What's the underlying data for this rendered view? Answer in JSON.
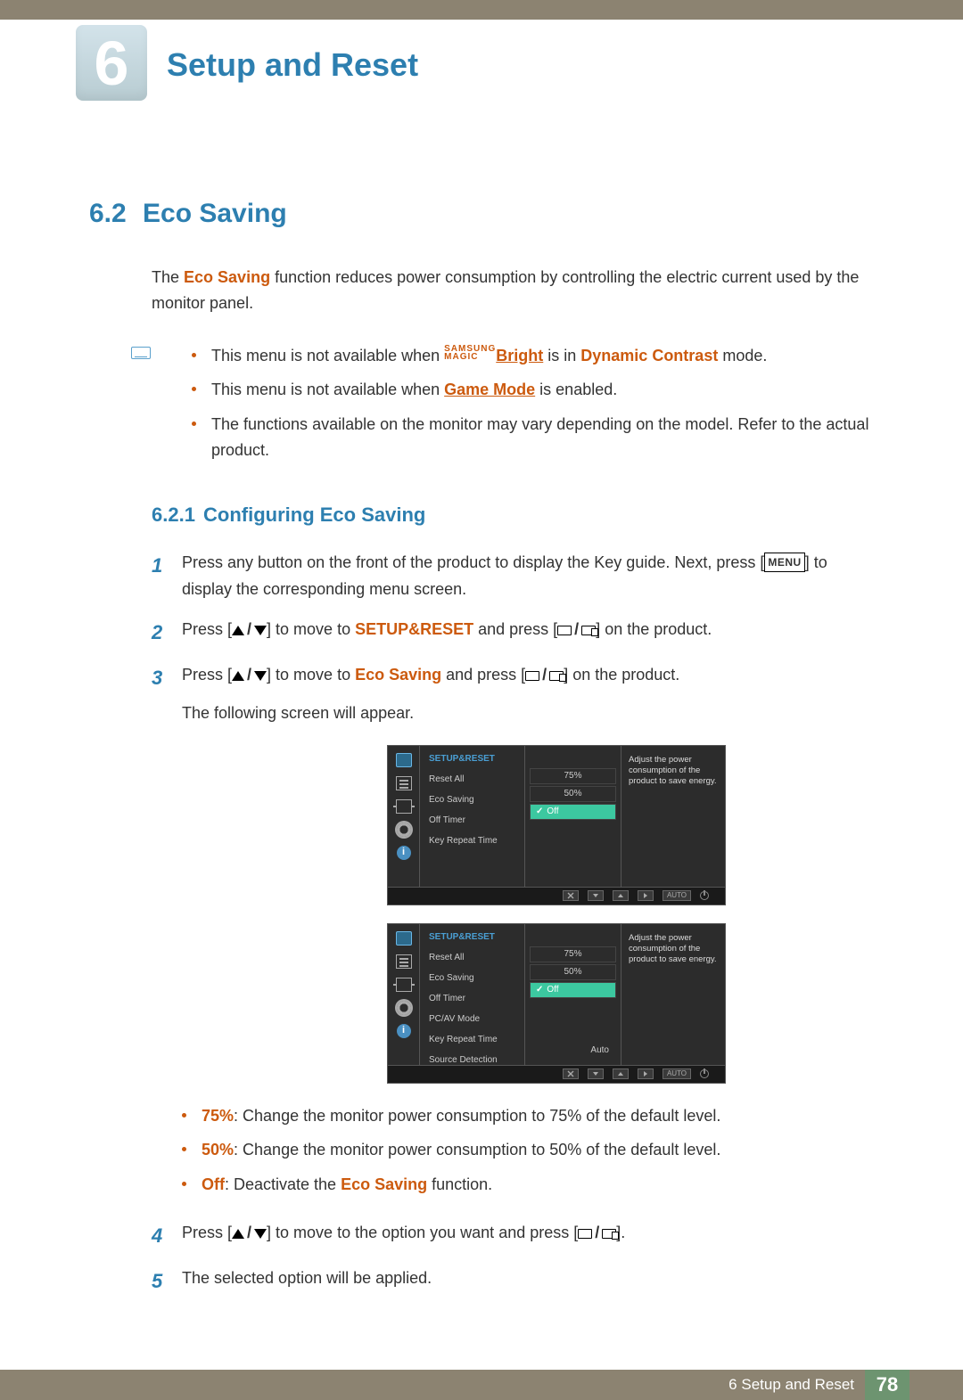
{
  "chapter": {
    "number": "6",
    "title": "Setup and Reset"
  },
  "section": {
    "number": "6.2",
    "title": "Eco Saving"
  },
  "intro": {
    "pre": "The ",
    "term": "Eco Saving",
    "post": " function reduces power consumption by controlling the electric current used by the monitor panel."
  },
  "notes": {
    "n1_pre": "This menu is not available when ",
    "n1_magic_top": "SAMSUNG",
    "n1_magic_bot": "MAGIC",
    "n1_bright": "Bright",
    "n1_mid": " is in ",
    "n1_dc": "Dynamic Contrast",
    "n1_post": " mode.",
    "n2_pre": "This menu is not available when ",
    "n2_gm": "Game Mode",
    "n2_post": " is enabled.",
    "n3": "The functions available on the monitor may vary depending on the model. Refer to the actual product."
  },
  "subsection": {
    "number": "6.2.1",
    "title": "Configuring Eco Saving"
  },
  "steps": {
    "s1_a": "Press any button on the front of the product to display the Key guide. Next, press [",
    "s1_menu": "MENU",
    "s1_b": "] to display the corresponding menu screen.",
    "s2_a": "Press [",
    "s2_b": "] to move to ",
    "s2_tgt": "SETUP&RESET",
    "s2_c": " and press [",
    "s2_d": "] on the product.",
    "s3_a": "Press [",
    "s3_b": "] to move to ",
    "s3_tgt": "Eco Saving",
    "s3_c": " and press [",
    "s3_d": "] on the product.",
    "s3_e": "The following screen will appear.",
    "s4_a": "Press [",
    "s4_b": "] to move to the option you want and press [",
    "s4_c": "].",
    "s5": "The selected option will be applied."
  },
  "osd": {
    "header": "SETUP&RESET",
    "desc": "Adjust the power consumption of the product to save energy.",
    "menu1": [
      "Reset All",
      "Eco Saving",
      "Off Timer",
      "Key Repeat Time"
    ],
    "menu2": [
      "Reset All",
      "Eco Saving",
      "Off Timer",
      "PC/AV Mode",
      "Key Repeat Time",
      "Source Detection"
    ],
    "vals": {
      "v75": "75%",
      "v50": "50%",
      "off": "Off",
      "auto": "Auto"
    },
    "ctrl_auto": "AUTO"
  },
  "results": {
    "r75_t": "75%",
    "r75": ": Change the monitor power consumption to 75% of the default level.",
    "r50_t": "50%",
    "r50": ": Change the monitor power consumption to 50% of the default level.",
    "roff_t": "Off",
    "roff_a": ": Deactivate the ",
    "roff_b": "Eco Saving",
    "roff_c": " function."
  },
  "footer": {
    "chapter_label": "6 Setup and Reset",
    "page": "78"
  }
}
